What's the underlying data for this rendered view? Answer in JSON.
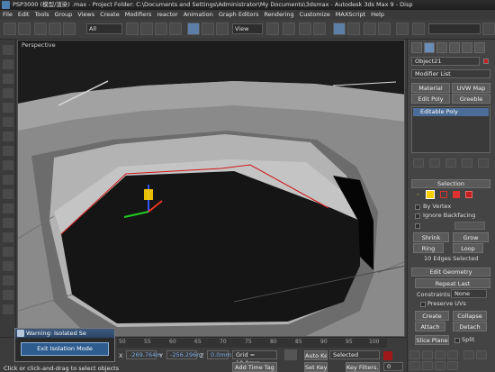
{
  "window": {
    "title": "PSP3000 (模型/渲染) .max  - Project Folder: C:\\Documents and Settings\\Administrator\\My Documents\\3dsmax   - Autodesk 3ds Max 9   - Disp"
  },
  "menu": [
    "File",
    "Edit",
    "Tools",
    "Group",
    "Views",
    "Create",
    "Modifiers",
    "reactor",
    "Animation",
    "Graph Editors",
    "Rendering",
    "Customize",
    "MAXScript",
    "Help"
  ],
  "toolbar": {
    "selection_filter": "All",
    "ref_coord": "View"
  },
  "viewport": {
    "label": "Perspective"
  },
  "command_panel": {
    "object_name": "Object21",
    "modifier_list": "Modifier List",
    "buttons": [
      "Material",
      "UVW Map",
      "Edit Poly",
      "Greeble"
    ],
    "stack_item": "Editable Poly",
    "selection": {
      "title": "Selection",
      "by_vertex": "By Vertex",
      "ignore_backfacing": "Ignore Backfacing",
      "shrink": "Shrink",
      "grow": "Grow",
      "ring": "Ring",
      "loop": "Loop",
      "status": "10 Edges Selected"
    },
    "edit_geometry": {
      "title": "Edit Geometry",
      "repeat_last": "Repeat Last",
      "constraints_label": "Constraints:",
      "constraints_value": "None",
      "preserve_uvs": "Preserve UVs",
      "create": "Create",
      "collapse": "Collapse",
      "attach": "Attach",
      "detach": "Detach",
      "slice_plane": "Slice Plane",
      "split": "Split"
    }
  },
  "isolation": {
    "title": "Warning: Isolated Se",
    "button": "Exit Isolation Mode"
  },
  "status": {
    "prompt": "Click or click-and-drag to select objects",
    "x": "-269.764m",
    "y": "-256.296m",
    "z": "0.0mm",
    "grid": "Grid = 10.0mm",
    "auto_key": "Auto Key",
    "selected": "Selected",
    "set_key": "Set Key",
    "key_filters": "Key Filters...",
    "add_time_tag": "Add Time Tag",
    "frame": "0",
    "ticks": [
      "50",
      "55",
      "60",
      "65",
      "70",
      "75",
      "80",
      "85",
      "90",
      "95",
      "100"
    ]
  },
  "colors": {
    "background": "#3c3c3c",
    "viewport": "#1c1c1c",
    "accent": "#2e5c8e",
    "selected_edge": "#d01818",
    "auto_key_active": "#a01818"
  }
}
